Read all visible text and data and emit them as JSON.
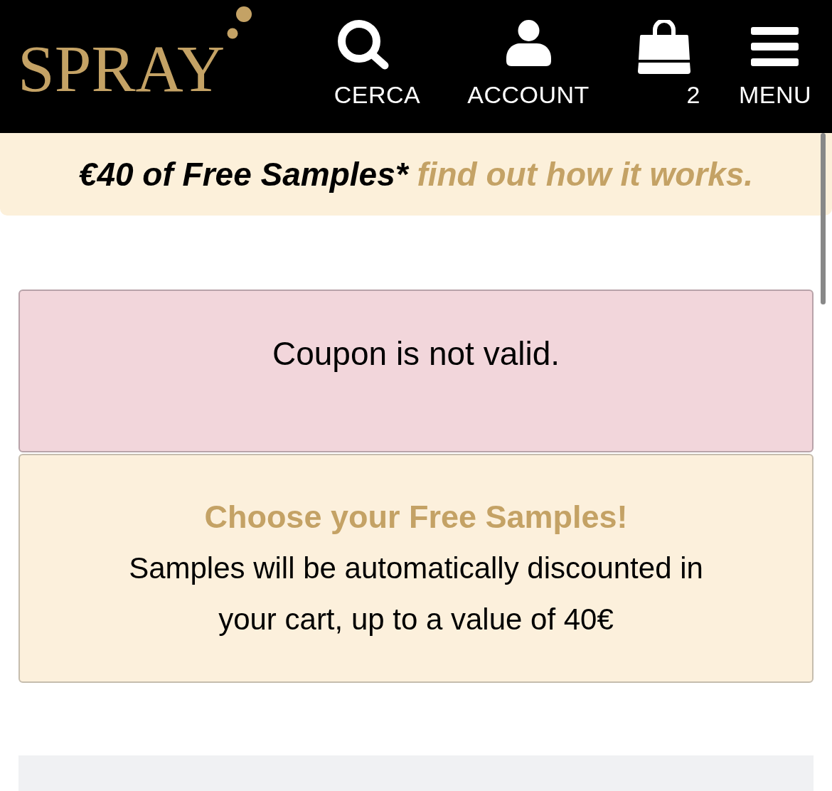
{
  "header": {
    "logo": "SPRAY",
    "nav": [
      {
        "kind": "search",
        "label": "CERCA"
      },
      {
        "kind": "account",
        "label": "ACCOUNT"
      },
      {
        "kind": "cart",
        "label": "2"
      },
      {
        "kind": "menu",
        "label": "MENU"
      }
    ]
  },
  "promo_banner": {
    "text": "€40 of Free Samples*",
    "link": "find out how it works."
  },
  "alerts": [
    {
      "kind": "error",
      "message": "Coupon is not valid."
    },
    {
      "kind": "info",
      "title": "Choose your Free Samples!",
      "message": "Samples will be automatically discounted in your cart, up to a value of 40€"
    }
  ]
}
